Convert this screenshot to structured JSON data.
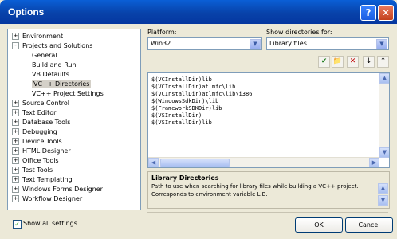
{
  "window": {
    "title": "Options",
    "help_icon": "?",
    "close_icon": "✕"
  },
  "tree": [
    {
      "label": "Environment",
      "expander": "+"
    },
    {
      "label": "Projects and Solutions",
      "expander": "-"
    },
    {
      "label": "General"
    },
    {
      "label": "Build and Run"
    },
    {
      "label": "VB Defaults"
    },
    {
      "label": "VC++ Directories",
      "selected": true
    },
    {
      "label": "VC++ Project Settings"
    },
    {
      "label": "Source Control",
      "expander": "+"
    },
    {
      "label": "Text Editor",
      "expander": "+"
    },
    {
      "label": "Database Tools",
      "expander": "+"
    },
    {
      "label": "Debugging",
      "expander": "+"
    },
    {
      "label": "Device Tools",
      "expander": "+"
    },
    {
      "label": "HTML Designer",
      "expander": "+"
    },
    {
      "label": "Office Tools",
      "expander": "+"
    },
    {
      "label": "Test Tools",
      "expander": "+"
    },
    {
      "label": "Text Templating",
      "expander": "+"
    },
    {
      "label": "Windows Forms Designer",
      "expander": "+"
    },
    {
      "label": "Workflow Designer",
      "expander": "+"
    }
  ],
  "platform": {
    "label": "Platform:",
    "value": "Win32"
  },
  "show_dirs": {
    "label": "Show directories for:",
    "value": "Library files"
  },
  "toolbar": {
    "check": "✔",
    "folder": "📁",
    "delete": "✕",
    "down": "↓",
    "up": "↑"
  },
  "directories": [
    "$(VCInstallDir)lib",
    "$(VCInstallDir)atlmfc\\lib",
    "$(VCInstallDir)atlmfc\\lib\\i386",
    "$(WindowsSdkDir)\\lib",
    "$(FrameworkSDKDir)lib",
    "$(VSInstallDir)",
    "$(VSInstallDir)lib"
  ],
  "description": {
    "title": "Library Directories",
    "text_line1": "Path to use when searching for library files while building a VC++ project.",
    "text_line2": "Corresponds to environment variable LIB."
  },
  "footer": {
    "show_all": "Show all settings",
    "ok": "OK",
    "cancel": "Cancel",
    "checked": true
  },
  "colors": {
    "title_bar": "#0842a9",
    "close": "#c3401d",
    "window": "#ECE9D8",
    "selection": "#d4d0c8"
  }
}
